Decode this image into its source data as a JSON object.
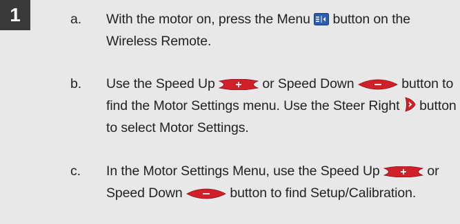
{
  "step_number": "1",
  "steps": {
    "a": {
      "letter": "a.",
      "t1": "With the motor on, press the Menu",
      "t2": "button on the Wireless Remote."
    },
    "b": {
      "letter": "b.",
      "t1": "Use the Speed Up",
      "t2": "or Speed Down",
      "t3": "button to find the Motor Settings menu. Use the Steer Right",
      "t4": "button to select Motor Settings."
    },
    "c": {
      "letter": "c.",
      "t1": "In the Motor Settings Menu, use the Speed Up",
      "t2": "or Speed Down",
      "t3": "button to find Setup/Calibration."
    }
  },
  "icons": {
    "menu": "menu-button-icon",
    "speed_up": "speed-up-button-icon",
    "speed_down": "speed-down-button-icon",
    "steer_right": "steer-right-button-icon"
  },
  "colors": {
    "button_red": "#d0202a",
    "menu_blue": "#2a5fb0",
    "badge": "#3a3a3a"
  }
}
